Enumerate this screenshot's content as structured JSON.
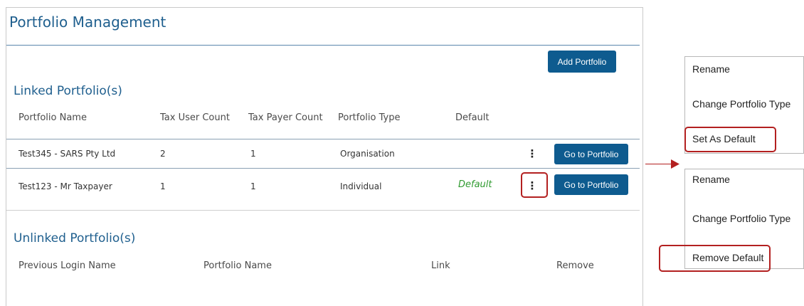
{
  "page": {
    "title": "Portfolio Management"
  },
  "actions": {
    "add_portfolio": "Add Portfolio"
  },
  "linked": {
    "title": "Linked Portfolio(s)",
    "columns": [
      "Portfolio Name",
      "Tax User Count",
      "Tax Payer Count",
      "Portfolio Type",
      "Default"
    ],
    "rows": [
      {
        "name": "Test345 - SARS Pty Ltd",
        "tax_user_count": "2",
        "tax_payer_count": "1",
        "type": "Organisation",
        "default": "",
        "menu_icon": "⋮",
        "action": "Go to Portfolio"
      },
      {
        "name": "Test123 - Mr Taxpayer",
        "tax_user_count": "1",
        "tax_payer_count": "1",
        "type": "Individual",
        "default": "Default",
        "menu_icon": "⋮",
        "action": "Go to Portfolio"
      }
    ]
  },
  "unlinked": {
    "title": "Unlinked Portfolio(s)",
    "columns": [
      "Previous Login Name",
      "Portfolio Name",
      "Link",
      "Remove"
    ]
  },
  "menus": {
    "top": [
      "Rename",
      "Change Portfolio Type",
      "Set As Default"
    ],
    "bottom": [
      "Rename",
      "Change Portfolio Type",
      "Remove Default"
    ]
  },
  "colors": {
    "accent": "#0e5b8f",
    "heading": "#1f5f8e",
    "default_text": "#2f9a2f",
    "highlight": "#b32020"
  }
}
